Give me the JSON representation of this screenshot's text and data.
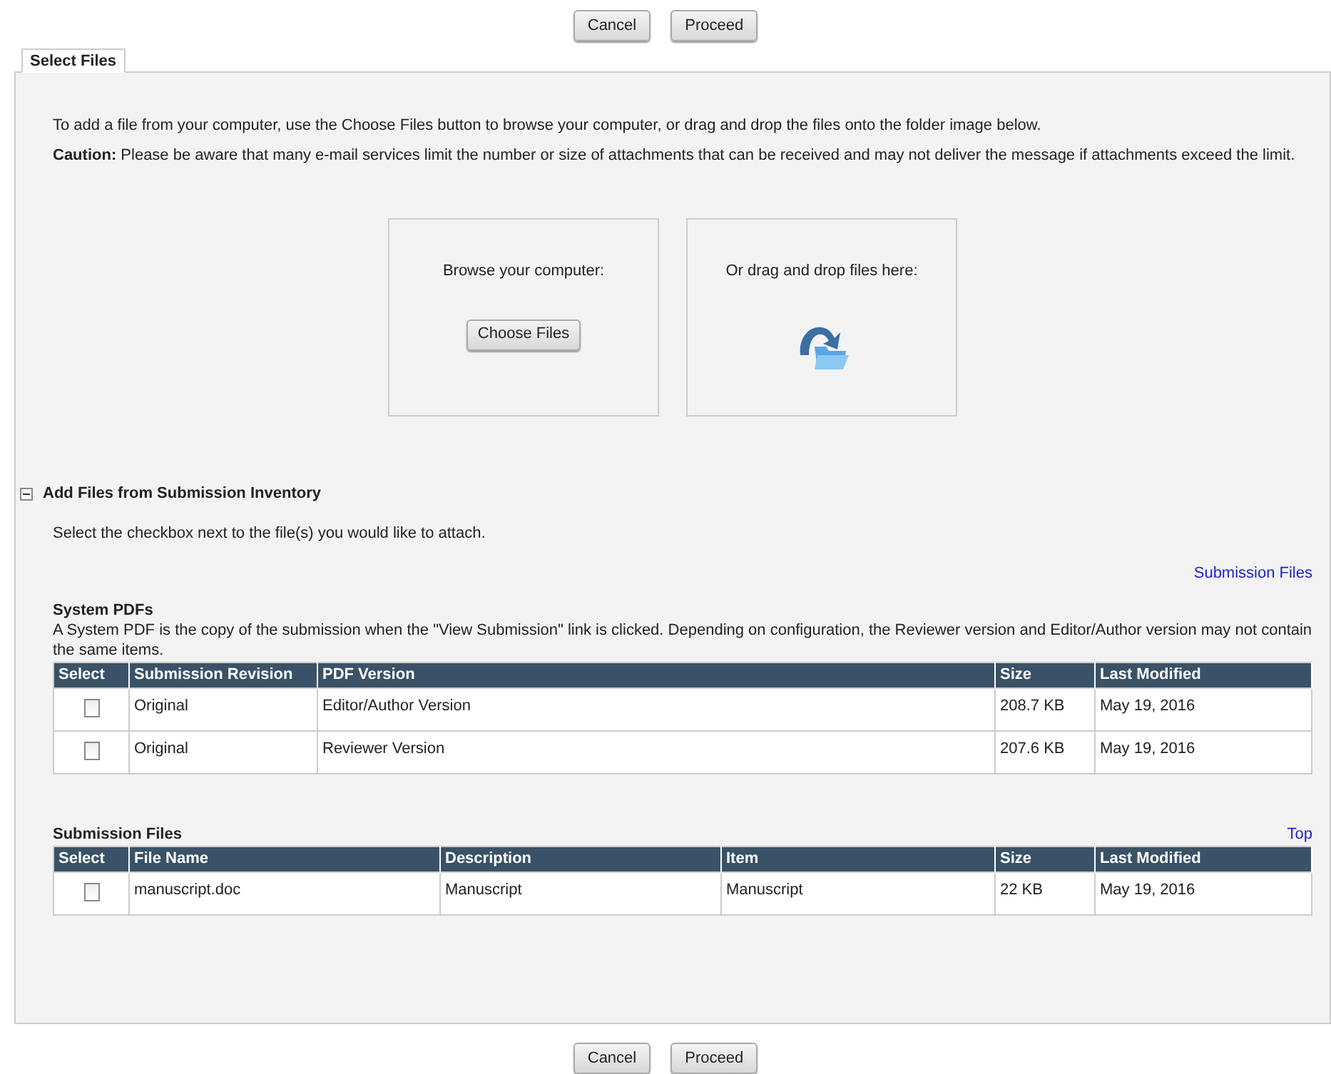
{
  "top_buttons": [
    "Cancel",
    "Proceed"
  ],
  "tab": {
    "label": "Select Files",
    "selected": true
  },
  "intro": "To add a file from your computer, use the Choose Files button to browse your computer, or drag and drop the files onto the folder image below.",
  "caution": "**Caution:** Please be aware that many e-mail services limit the number or size of attachments that can be received and may not deliver the message if attachments exceed the limit.",
  "browse": {
    "label": "Browse your computer:",
    "button": "Choose Files"
  },
  "drop": {
    "label": "Or drag and drop files here:"
  },
  "inventory": {
    "title": "Add Files from Submission Inventory",
    "expanded": true,
    "instruction": "Select the checkbox next to the file(s) you would like to attach.",
    "link": "Submission Files",
    "system_pdfs": {
      "title": "System PDFs",
      "note": "A System PDF is the copy of the submission when the \"View Submission\" link is clicked. Depending on configuration, the Reviewer version and Editor/Author version may not contain the same items.",
      "select_column": "Select",
      "columns": [
        "Submission Revision",
        "PDF Version",
        "Size",
        "Last Modified"
      ],
      "rows": [
        {
          "checked": false,
          "cells": [
            "Original",
            "Editor/Author Version",
            "208.7 KB",
            "May 19, 2016"
          ]
        },
        {
          "checked": false,
          "cells": [
            "Original",
            "Reviewer Version",
            "207.6 KB",
            "May 19, 2016"
          ]
        }
      ]
    },
    "submission_files": {
      "title": "Submission Files",
      "link": "Top",
      "select_column": "Select",
      "columns": [
        "File Name",
        "Description",
        "Item",
        "Size",
        "Last Modified"
      ],
      "rows": [
        {
          "checked": false,
          "cells": [
            "manuscript.doc",
            "Manuscript",
            "Manuscript",
            "22 KB",
            "May 19, 2016"
          ]
        }
      ]
    }
  },
  "bottom_buttons": [
    "Cancel",
    "Proceed"
  ]
}
